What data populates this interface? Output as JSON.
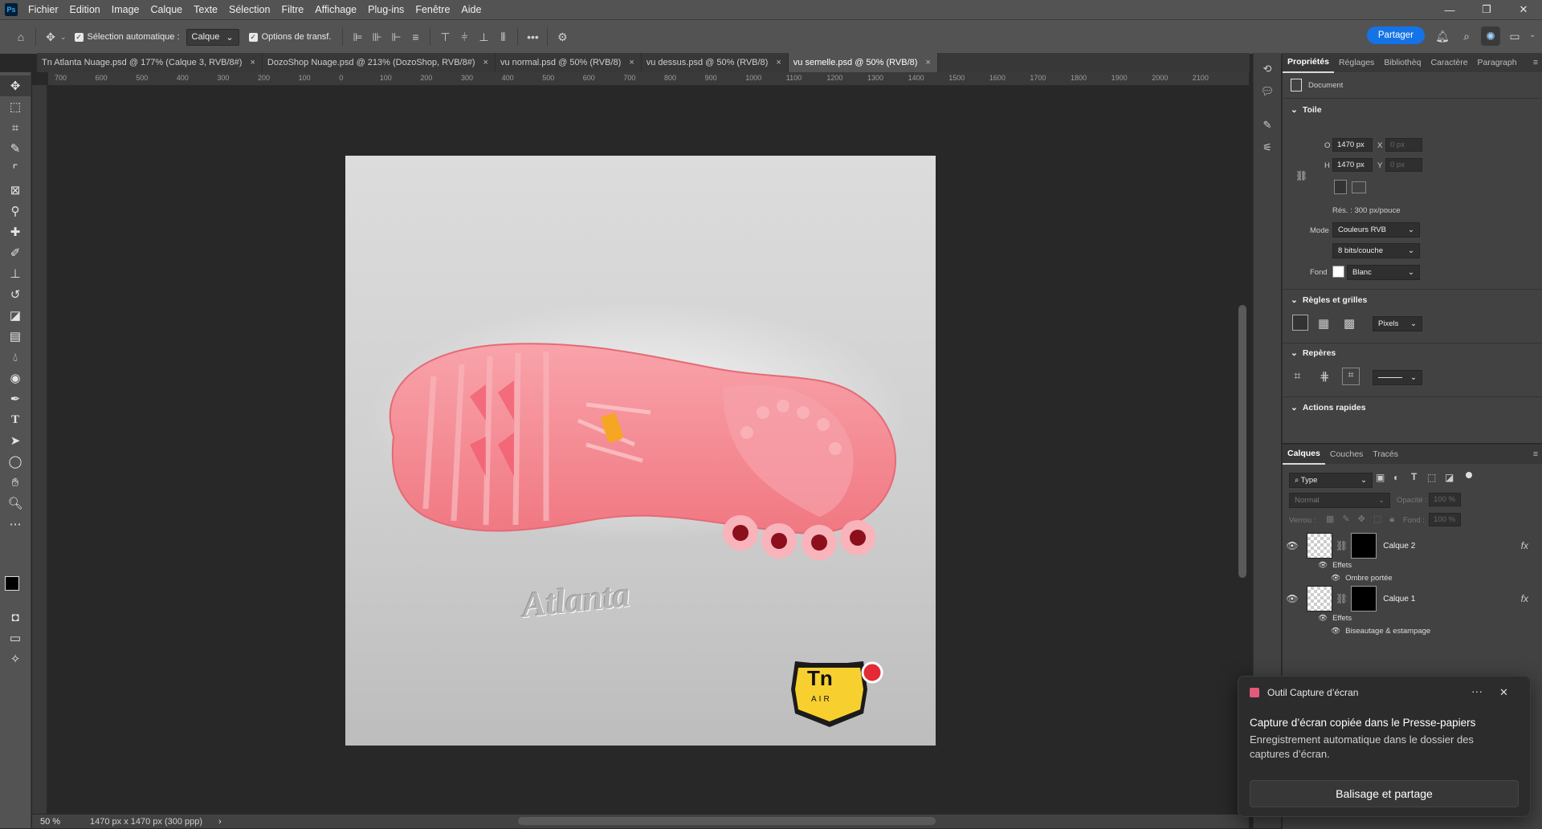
{
  "menu": {
    "app_icon": "Ps",
    "items": [
      "Fichier",
      "Edition",
      "Image",
      "Calque",
      "Texte",
      "Sélection",
      "Filtre",
      "Affichage",
      "Plug-ins",
      "Fenêtre",
      "Aide"
    ]
  },
  "window_controls": [
    "—",
    "❐",
    "✕"
  ],
  "options": {
    "auto_select_label": "Sélection automatique :",
    "auto_select_value": "Calque",
    "transform_label": "Options de transf.",
    "more": "•••",
    "share_label": "Partager"
  },
  "tabs": [
    {
      "label": "Tn Atlanta Nuage.psd @ 177% (Calque 3, RVB/8#)",
      "close": "×"
    },
    {
      "label": "DozoShop Nuage.psd @ 213% (DozoShop, RVB/8#)",
      "close": "×"
    },
    {
      "label": "vu normal.psd @ 50% (RVB/8)",
      "close": "×"
    },
    {
      "label": "vu dessus.psd @ 50% (RVB/8)",
      "close": "×"
    },
    {
      "label": "vu semelle.psd @ 50% (RVB/8)",
      "close": "×"
    }
  ],
  "ruler_ticks": [
    "700",
    "600",
    "500",
    "400",
    "300",
    "200",
    "100",
    "0",
    "100",
    "200",
    "300",
    "400",
    "500",
    "600",
    "700",
    "800",
    "900",
    "1000",
    "1100",
    "1200",
    "1300",
    "1400",
    "1500",
    "1600",
    "1700",
    "1800",
    "1900",
    "2000",
    "2100"
  ],
  "canvas": {
    "brand_text": "Atlanta",
    "logo_top": "Tn",
    "logo_bottom": "AIR",
    "sole_color": "#f4878f"
  },
  "status": {
    "zoom": "50 %",
    "doc_info": "1470 px x 1470 px (300 ppp)",
    "arrow": "›"
  },
  "properties": {
    "tabs": [
      "Propriétés",
      "Réglages",
      "Bibliothèq",
      "Caractère",
      "Paragraph"
    ],
    "doc_label": "Document",
    "canvas_section": "Toile",
    "w_label": "O",
    "w_value": "1470 px",
    "h_label": "H",
    "h_value": "1470 px",
    "x_label": "X",
    "x_value": "0 px",
    "y_label": "Y",
    "y_value": "0 px",
    "resolution": "Rés. : 300 px/pouce",
    "mode_label": "Mode",
    "mode_value": "Couleurs RVB",
    "depth_value": "8 bits/couche",
    "bg_label": "Fond",
    "bg_value": "Blanc",
    "rulers_section": "Règles et grilles",
    "units_value": "Pixels",
    "guides_section": "Repères",
    "quick_actions_section": "Actions rapides"
  },
  "layers": {
    "tabs": [
      "Calques",
      "Couches",
      "Tracés"
    ],
    "filter_value": "Type",
    "blend_mode": "Normal",
    "opacity_label": "Opacité :",
    "opacity_value": "100 %",
    "lock_label": "Verrou :",
    "fill_label": "Fond :",
    "fill_value": "100 %",
    "rows": [
      {
        "name": "Calque 2",
        "effects_label": "Effets",
        "effect": "Ombre portée",
        "fx": "fx"
      },
      {
        "name": "Calque 1",
        "effects_label": "Effets",
        "effect": "Biseautage & estampage",
        "fx": "fx"
      }
    ]
  },
  "notification": {
    "app": "Outil Capture d’écran",
    "more": "···",
    "close": "✕",
    "title": "Capture d’écran copiée dans le Presse-papiers",
    "body": "Enregistrement automatique dans le dossier des captures d’écran.",
    "button": "Balisage et partage"
  }
}
